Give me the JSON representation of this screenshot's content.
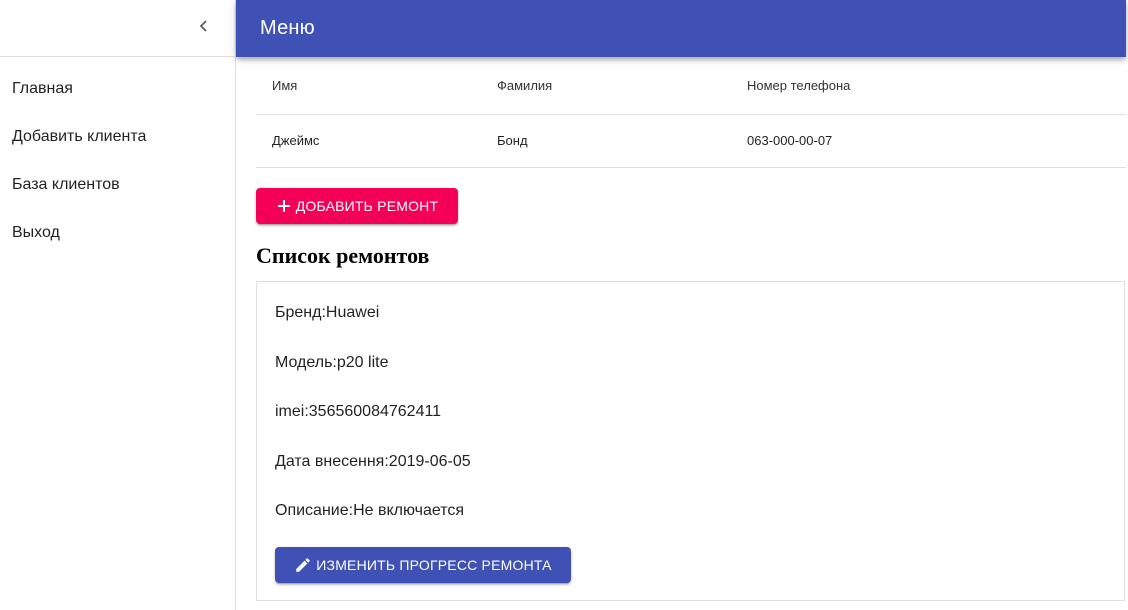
{
  "sidebar": {
    "items": [
      {
        "label": "Главная"
      },
      {
        "label": "Добавить клиента"
      },
      {
        "label": "База клиентов"
      },
      {
        "label": "Выход"
      }
    ]
  },
  "appbar": {
    "title": "Меню"
  },
  "clients_table": {
    "headers": [
      "Имя",
      "Фамилия",
      "Номер телефона"
    ],
    "rows": [
      [
        "Джеймс",
        "Бонд",
        "063-000-00-07"
      ]
    ]
  },
  "actions": {
    "add_repair_label": "Добавить ремонт",
    "edit_progress_label": "Изменить прогресс ремонта"
  },
  "repairs": {
    "title": "Список ремонтов",
    "items": [
      {
        "brand": "Бренд:Huawei",
        "model": "Модель:p20 lite",
        "imei": "imei:356560084762411",
        "date": "Дата внесення:2019-06-05",
        "description": "Описание:Не включается"
      }
    ]
  },
  "icons": {
    "collapse": "chevron-left-icon",
    "add": "plus-icon",
    "edit": "pencil-icon"
  },
  "colors": {
    "primary": "#3f51b5",
    "secondary": "#f50057"
  }
}
